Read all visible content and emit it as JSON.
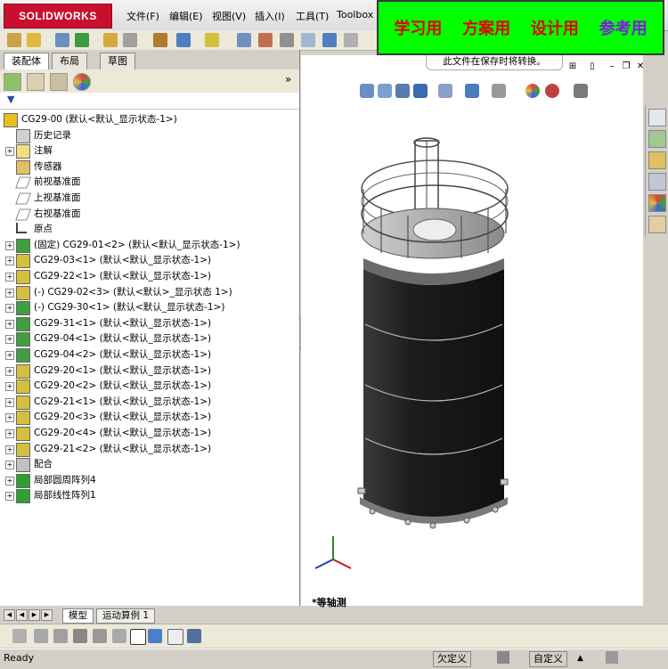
{
  "app": {
    "logo": "SOLIDWORKS"
  },
  "menu": [
    "文件(F)",
    "编辑(E)",
    "视图(V)",
    "插入(I)",
    "工具(T)",
    "Toolbox"
  ],
  "banner": [
    "学习用",
    "方案用",
    "设计用",
    "参考用"
  ],
  "notice": "此文件在保存时将转换。",
  "tabs": [
    "装配体",
    "布局",
    "草图"
  ],
  "bottom_tabs": [
    "模型",
    "运动算例 1"
  ],
  "view_label": "*等轴测",
  "status": {
    "left": "Ready",
    "mid": "欠定义",
    "right": "自定义"
  },
  "colors": {
    "banner_bg": "#00ff00",
    "banner_red": "#e00000",
    "banner_purple": "#7a1fd8",
    "tank": "#1c1c1c"
  },
  "tree": [
    {
      "label": "CG29-00  (默认<默认_显示状态-1>)",
      "icon": "assembly-icon"
    },
    {
      "label": "历史记录",
      "icon": "history-icon"
    },
    {
      "label": "注解",
      "icon": "annotation-icon"
    },
    {
      "label": "传感器",
      "icon": "sensor-icon"
    },
    {
      "label": "前视基准面",
      "icon": "plane-icon"
    },
    {
      "label": "上视基准面",
      "icon": "plane-icon"
    },
    {
      "label": "右视基准面",
      "icon": "plane-icon"
    },
    {
      "label": "原点",
      "icon": "origin-icon"
    },
    {
      "label": "(固定) CG29-01<2> (默认<默认_显示状态-1>)",
      "icon": "subassembly-icon"
    },
    {
      "label": "CG29-03<1> (默认<默认_显示状态-1>)",
      "icon": "part-icon"
    },
    {
      "label": "CG29-22<1> (默认<默认_显示状态-1>)",
      "icon": "part-icon"
    },
    {
      "label": "(-) CG29-02<3> (默认<默认>_显示状态 1>)",
      "icon": "part-icon"
    },
    {
      "label": "(-) CG29-30<1> (默认<默认_显示状态-1>)",
      "icon": "subassembly-icon"
    },
    {
      "label": "CG29-31<1> (默认<默认_显示状态-1>)",
      "icon": "subassembly-icon"
    },
    {
      "label": "CG29-04<1> (默认<默认_显示状态-1>)",
      "icon": "subassembly-icon"
    },
    {
      "label": "CG29-04<2> (默认<默认_显示状态-1>)",
      "icon": "subassembly-icon"
    },
    {
      "label": "CG29-20<1> (默认<默认_显示状态-1>)",
      "icon": "part-icon"
    },
    {
      "label": "CG29-20<2> (默认<默认_显示状态-1>)",
      "icon": "part-icon"
    },
    {
      "label": "CG29-21<1> (默认<默认_显示状态-1>)",
      "icon": "part-icon"
    },
    {
      "label": "CG29-20<3> (默认<默认_显示状态-1>)",
      "icon": "part-icon"
    },
    {
      "label": "CG29-20<4> (默认<默认_显示状态-1>)",
      "icon": "part-icon"
    },
    {
      "label": "CG29-21<2> (默认<默认_显示状态-1>)",
      "icon": "part-icon"
    },
    {
      "label": "配合",
      "icon": "mates-icon"
    },
    {
      "label": "局部圆周阵列4",
      "icon": "pattern-icon"
    },
    {
      "label": "局部线性阵列1",
      "icon": "pattern-icon"
    }
  ]
}
